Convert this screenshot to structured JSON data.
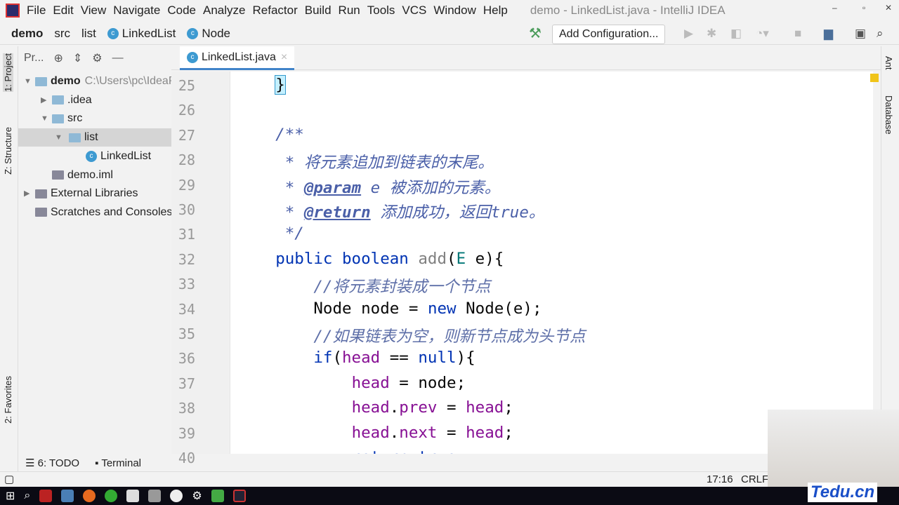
{
  "menu": {
    "items": [
      "File",
      "Edit",
      "View",
      "Navigate",
      "Code",
      "Analyze",
      "Refactor",
      "Build",
      "Run",
      "Tools",
      "VCS",
      "Window",
      "Help"
    ],
    "title": "demo - LinkedList.java - IntelliJ IDEA"
  },
  "breadcrumb": [
    "demo",
    "src",
    "list",
    "LinkedList",
    "Node"
  ],
  "toolbar": {
    "add_config": "Add Configuration..."
  },
  "side_tabs": {
    "project": "1: Project",
    "structure": "Z: Structure",
    "favorites": "2: Favorites",
    "ant": "Ant",
    "database": "Database"
  },
  "project": {
    "header": "Pr...",
    "tree": [
      {
        "label": "demo",
        "extra": "C:\\Users\\pc\\IdeaProjects",
        "depth": 0,
        "arrow": "▼",
        "icon": "folder"
      },
      {
        "label": ".idea",
        "depth": 1,
        "arrow": "▶",
        "icon": "folder"
      },
      {
        "label": "src",
        "depth": 1,
        "arrow": "▼",
        "icon": "folder"
      },
      {
        "label": "list",
        "depth": 2,
        "arrow": "▼",
        "icon": "folder",
        "selected": true
      },
      {
        "label": "LinkedList",
        "depth": 3,
        "icon": "class"
      },
      {
        "label": "demo.iml",
        "depth": 1,
        "icon": "file"
      },
      {
        "label": "External Libraries",
        "depth": 0,
        "arrow": "▶",
        "icon": "lib"
      },
      {
        "label": "Scratches and Consoles",
        "depth": 0,
        "icon": "scratch"
      }
    ]
  },
  "editor": {
    "tab": "LinkedList.java",
    "lines": [
      {
        "n": "25",
        "t": [
          [
            "    ",
            ""
          ],
          [
            "}",
            "br"
          ]
        ]
      },
      {
        "n": "26",
        "t": []
      },
      {
        "n": "27",
        "t": [
          [
            "    /**",
            "cm"
          ]
        ]
      },
      {
        "n": "28",
        "t": [
          [
            "     * 将元素追加到链表的末尾。",
            "cm"
          ]
        ]
      },
      {
        "n": "29",
        "t": [
          [
            "     * ",
            "cm"
          ],
          [
            "@param",
            "tag"
          ],
          [
            " e 被添加的元素。",
            "cm"
          ]
        ]
      },
      {
        "n": "30",
        "t": [
          [
            "     * ",
            "cm"
          ],
          [
            "@return",
            "tag"
          ],
          [
            " 添加成功，返回true。",
            "cm"
          ]
        ]
      },
      {
        "n": "31",
        "t": [
          [
            "     */",
            "cm"
          ]
        ]
      },
      {
        "n": "32",
        "t": [
          [
            "    ",
            ""
          ],
          [
            "public boolean ",
            "kw"
          ],
          [
            "add",
            "unused"
          ],
          [
            "(",
            ""
          ],
          [
            "E",
            "tp"
          ],
          [
            " e){",
            ""
          ]
        ]
      },
      {
        "n": "33",
        "t": [
          [
            "        //将元素封装成一个节点",
            "lc"
          ]
        ]
      },
      {
        "n": "34",
        "t": [
          [
            "        Node node = ",
            ""
          ],
          [
            "new",
            "kw"
          ],
          [
            " Node(e);",
            ""
          ]
        ]
      },
      {
        "n": "35",
        "t": [
          [
            "        //如果链表为空，则新节点成为头节点",
            "lc"
          ]
        ]
      },
      {
        "n": "36",
        "t": [
          [
            "        ",
            ""
          ],
          [
            "if",
            "kw"
          ],
          [
            "(",
            ""
          ],
          [
            "head",
            "fld"
          ],
          [
            " == ",
            ""
          ],
          [
            "null",
            "kw"
          ],
          [
            "){",
            ""
          ]
        ]
      },
      {
        "n": "37",
        "t": [
          [
            "            ",
            ""
          ],
          [
            "head",
            "fld"
          ],
          [
            " = node;",
            ""
          ]
        ]
      },
      {
        "n": "38",
        "t": [
          [
            "            ",
            ""
          ],
          [
            "head",
            "fld"
          ],
          [
            ".",
            ""
          ],
          [
            "prev",
            "fld"
          ],
          [
            " = ",
            ""
          ],
          [
            "head",
            "fld"
          ],
          [
            ";",
            ""
          ]
        ]
      },
      {
        "n": "39",
        "t": [
          [
            "            ",
            ""
          ],
          [
            "head",
            "fld"
          ],
          [
            ".",
            ""
          ],
          [
            "next",
            "fld"
          ],
          [
            " = ",
            ""
          ],
          [
            "head",
            "fld"
          ],
          [
            ";",
            ""
          ]
        ]
      },
      {
        "n": "40",
        "t": [
          [
            "            ",
            ""
          ],
          [
            "return true",
            "kw"
          ],
          [
            ";",
            ""
          ]
        ]
      }
    ]
  },
  "bottom": {
    "todo": "6: TODO",
    "terminal": "Terminal"
  },
  "status": {
    "position": "17:16",
    "line_sep": "CRLF"
  },
  "watermark": "Tedu.cn"
}
